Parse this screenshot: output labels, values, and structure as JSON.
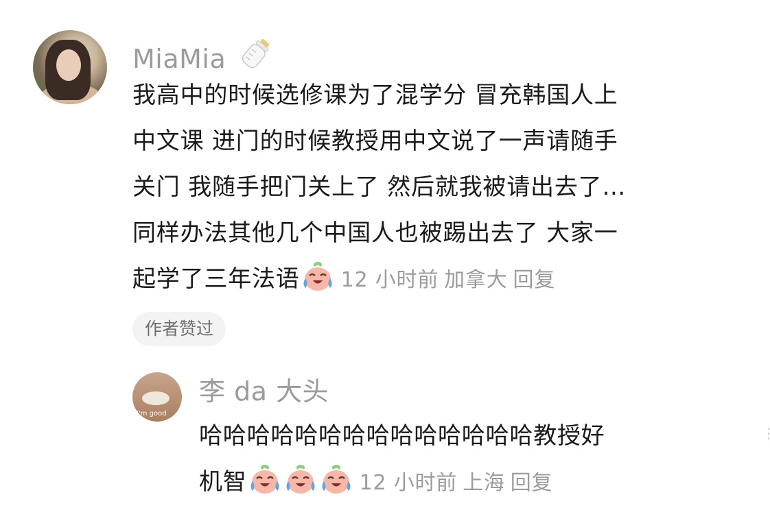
{
  "comment": {
    "username": "MiaMia",
    "username_emoji": "baby-bottle-icon",
    "lines": [
      "我高中的时候选修课为了混学分 冒充韩国人上",
      "中文课 进门的时候教授用中文说了一声请随手",
      "关门 我随手把门关上了 然后就我被请出去了…",
      "同样办法其他几个中国人也被踢出去了 大家一",
      "起学了三年法语"
    ],
    "emoji": "laughing-crying-face-icon",
    "time": "12 小时前",
    "location": "加拿大",
    "reply_label": "回复",
    "author_liked_badge": "作者赞过"
  },
  "reply": {
    "username": "李 da 大头",
    "avatar_caption": "I'm good",
    "lines": [
      "哈哈哈哈哈哈哈哈哈哈哈哈哈哈教授好",
      "机智"
    ],
    "emoji": "laughing-crying-face-icon",
    "emoji_count": 3,
    "time": "12 小时前",
    "location": "上海",
    "reply_label": "回复"
  },
  "colors": {
    "text": "#1a1a1a",
    "meta": "#9b9b9b",
    "badge_bg": "#f3f3f3",
    "emoji_face": "#f6b7a8"
  }
}
